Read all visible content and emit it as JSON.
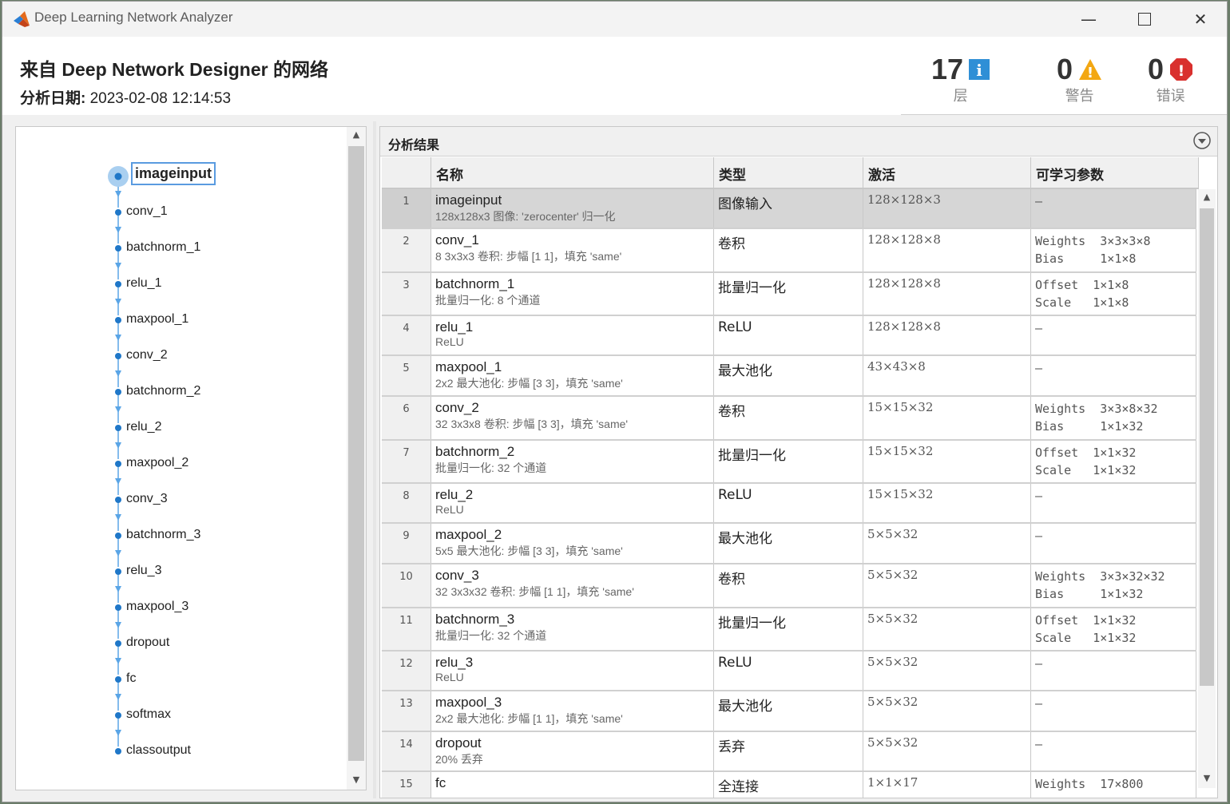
{
  "window": {
    "title": "Deep Learning Network Analyzer"
  },
  "header": {
    "network_title": "来自 Deep Network Designer 的网络",
    "date_label": "分析日期:",
    "date_value": "2023-02-08 12:14:53"
  },
  "stats": {
    "layers": {
      "value": "17",
      "label": "层",
      "icon": "info-icon"
    },
    "warnings": {
      "value": "0",
      "label": "警告",
      "icon": "warning-icon"
    },
    "errors": {
      "value": "0",
      "label": "错误",
      "icon": "error-icon"
    }
  },
  "graph": {
    "nodes": [
      "imageinput",
      "conv_1",
      "batchnorm_1",
      "relu_1",
      "maxpool_1",
      "conv_2",
      "batchnorm_2",
      "relu_2",
      "maxpool_2",
      "conv_3",
      "batchnorm_3",
      "relu_3",
      "maxpool_3",
      "dropout",
      "fc",
      "softmax",
      "classoutput"
    ],
    "selected": "imageinput"
  },
  "results": {
    "title": "分析结果",
    "columns": [
      "名称",
      "类型",
      "激活",
      "可学习参数"
    ],
    "rows": [
      {
        "idx": "1",
        "name": "imageinput",
        "desc": "128x128x3 图像: 'zerocenter' 归一化",
        "type": "图像输入",
        "act": "128×128×3",
        "params": [
          "–"
        ]
      },
      {
        "idx": "2",
        "name": "conv_1",
        "desc": "8 3x3x3 卷积: 步幅 [1 1]，填充 'same'",
        "type": "卷积",
        "act": "128×128×8",
        "params": [
          "Weights  3×3×3×8",
          "Bias     1×1×8"
        ]
      },
      {
        "idx": "3",
        "name": "batchnorm_1",
        "desc": "批量归一化: 8 个通道",
        "type": "批量归一化",
        "act": "128×128×8",
        "params": [
          "Offset  1×1×8",
          "Scale   1×1×8"
        ]
      },
      {
        "idx": "4",
        "name": "relu_1",
        "desc": "ReLU",
        "type": "ReLU",
        "act": "128×128×8",
        "params": [
          "–"
        ]
      },
      {
        "idx": "5",
        "name": "maxpool_1",
        "desc": "2x2 最大池化: 步幅 [3 3]，填充 'same'",
        "type": "最大池化",
        "act": "43×43×8",
        "params": [
          "–"
        ]
      },
      {
        "idx": "6",
        "name": "conv_2",
        "desc": "32 3x3x8 卷积: 步幅 [3 3]，填充 'same'",
        "type": "卷积",
        "act": "15×15×32",
        "params": [
          "Weights  3×3×8×32",
          "Bias     1×1×32"
        ]
      },
      {
        "idx": "7",
        "name": "batchnorm_2",
        "desc": "批量归一化: 32 个通道",
        "type": "批量归一化",
        "act": "15×15×32",
        "params": [
          "Offset  1×1×32",
          "Scale   1×1×32"
        ]
      },
      {
        "idx": "8",
        "name": "relu_2",
        "desc": "ReLU",
        "type": "ReLU",
        "act": "15×15×32",
        "params": [
          "–"
        ]
      },
      {
        "idx": "9",
        "name": "maxpool_2",
        "desc": "5x5 最大池化: 步幅 [3 3]，填充 'same'",
        "type": "最大池化",
        "act": "5×5×32",
        "params": [
          "–"
        ]
      },
      {
        "idx": "10",
        "name": "conv_3",
        "desc": "32 3x3x32 卷积: 步幅 [1 1]，填充 'same'",
        "type": "卷积",
        "act": "5×5×32",
        "params": [
          "Weights  3×3×32×32",
          "Bias     1×1×32"
        ]
      },
      {
        "idx": "11",
        "name": "batchnorm_3",
        "desc": "批量归一化: 32 个通道",
        "type": "批量归一化",
        "act": "5×5×32",
        "params": [
          "Offset  1×1×32",
          "Scale   1×1×32"
        ]
      },
      {
        "idx": "12",
        "name": "relu_3",
        "desc": "ReLU",
        "type": "ReLU",
        "act": "5×5×32",
        "params": [
          "–"
        ]
      },
      {
        "idx": "13",
        "name": "maxpool_3",
        "desc": "2x2 最大池化: 步幅 [1 1]，填充 'same'",
        "type": "最大池化",
        "act": "5×5×32",
        "params": [
          "–"
        ]
      },
      {
        "idx": "14",
        "name": "dropout",
        "desc": "20% 丢弃",
        "type": "丢弃",
        "act": "5×5×32",
        "params": [
          "–"
        ]
      },
      {
        "idx": "15",
        "name": "fc",
        "desc": "",
        "type": "全连接",
        "act": "1×1×17",
        "params": [
          "Weights  17×800"
        ]
      }
    ]
  },
  "colors": {
    "accent": "#1f77c8",
    "edge": "#5aa5e6",
    "warning": "#f3a712",
    "error": "#d9302e",
    "info": "#2f8fd6"
  }
}
